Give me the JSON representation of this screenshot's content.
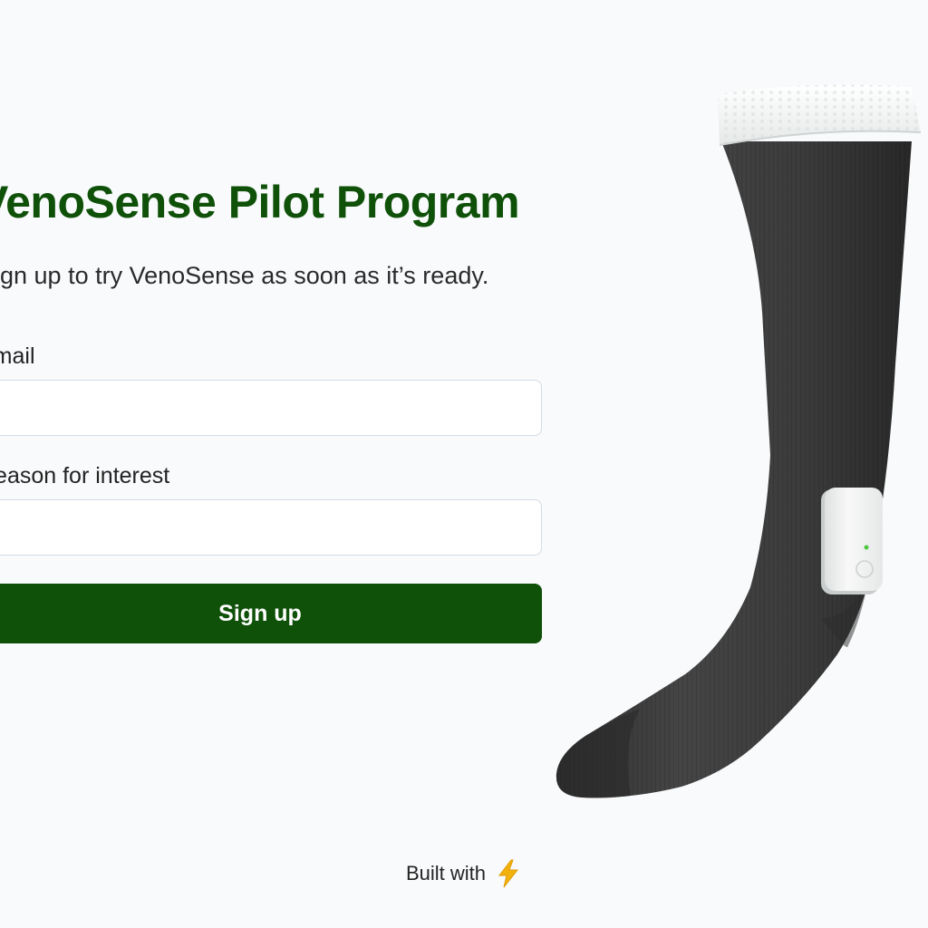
{
  "form": {
    "title": "VenoSense Pilot Program",
    "subtitle": "Sign up to try VenoSense as soon as it’s ready.",
    "email_label": "Email",
    "email_value": "",
    "reason_label": "Reason for interest",
    "reason_value": "",
    "submit_label": "Sign up"
  },
  "footer": {
    "text": "Built with",
    "icon": "lightning-bolt-icon"
  },
  "product": {
    "name": "compression-sock-with-sensor",
    "icon": "sock-with-sensor-image"
  },
  "colors": {
    "brand_green": "#0f5109",
    "background": "#f8fafb",
    "sock": "#3a3a3a",
    "sensor": "#f3f4f4",
    "sensor_led": "#4cc83f",
    "bolt": "#f2b20d"
  }
}
